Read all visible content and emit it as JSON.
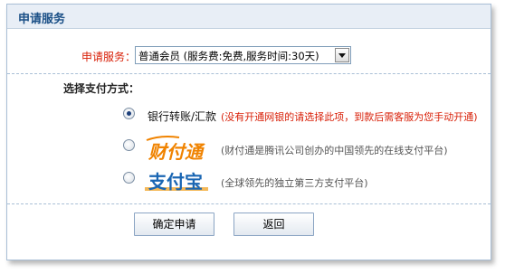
{
  "panel": {
    "title": "申请服务"
  },
  "service": {
    "label": "申请服务：",
    "selected": "普通会员 (服务费:免费,服务时间:30天)"
  },
  "payment": {
    "label": "选择支付方式：",
    "options": [
      {
        "name": "银行转账/汇款",
        "desc": "(没有开通网银的请选择此项，到款后需客服为您手动开通)",
        "checked": true
      },
      {
        "name": "财付通",
        "desc": "(财付通是腾讯公司创办的中国领先的在线支付平台)",
        "checked": false
      },
      {
        "name": "支付宝",
        "desc": "(全球领先的独立第三方支付平台)",
        "checked": false
      }
    ]
  },
  "buttons": {
    "confirm": "确定申请",
    "back": "返回"
  },
  "colors": {
    "accent": "#1a4f86",
    "required": "#d81e06",
    "tenpay": "#f08300",
    "alipay": "#1a66b3"
  }
}
